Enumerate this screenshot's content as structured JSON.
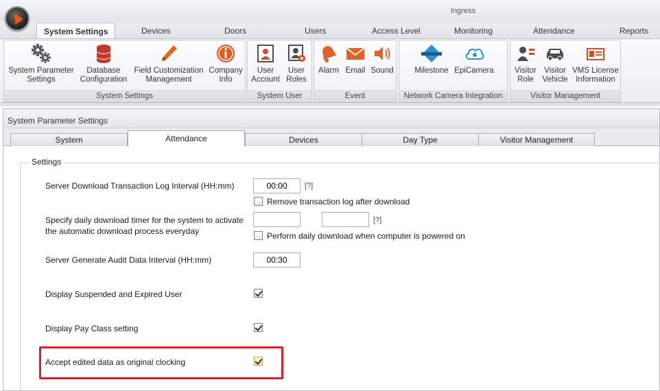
{
  "app": {
    "title": "Ingress"
  },
  "ribbon_tabs": [
    {
      "label": "System Settings",
      "active": true
    },
    {
      "label": "Devices"
    },
    {
      "label": "Doors"
    },
    {
      "label": "Users"
    },
    {
      "label": "Access Level"
    },
    {
      "label": "Monitoring"
    },
    {
      "label": "Attendance"
    },
    {
      "label": "Reports"
    }
  ],
  "ribbon_groups": {
    "system_settings": {
      "label": "System Settings",
      "buttons": [
        {
          "label": "System Parameter\nSettings",
          "icon": "gears-icon"
        },
        {
          "label": "Database\nConfiguration",
          "icon": "database-icon"
        },
        {
          "label": "Field Customization\nManagement",
          "icon": "pencil-icon"
        },
        {
          "label": "Company\nInfo",
          "icon": "info-icon"
        }
      ]
    },
    "system_user": {
      "label": "System User",
      "buttons": [
        {
          "label": "User\nAccount",
          "icon": "user-account-icon"
        },
        {
          "label": "User\nRoles",
          "icon": "user-roles-icon"
        }
      ]
    },
    "event": {
      "label": "Event",
      "buttons": [
        {
          "label": "Alarm",
          "icon": "alarm-bell-icon"
        },
        {
          "label": "Email",
          "icon": "email-icon"
        },
        {
          "label": "Sound",
          "icon": "speaker-icon"
        }
      ]
    },
    "network_camera": {
      "label": "Network Camera Integration",
      "buttons": [
        {
          "label": "Milestone",
          "icon": "milestone-icon",
          "logo_text": "milestone"
        },
        {
          "label": "EpiCamera",
          "icon": "cloud-camera-icon"
        }
      ]
    },
    "visitor_management": {
      "label": "Visitor Management",
      "buttons": [
        {
          "label": "Visitor\nRole",
          "icon": "visitor-role-icon"
        },
        {
          "label": "Visitor\nVehicle",
          "icon": "car-icon"
        },
        {
          "label": "VMS License\nInformation",
          "icon": "license-card-icon"
        }
      ]
    }
  },
  "panel": {
    "title": "System Parameter Settings",
    "tabs": [
      {
        "label": "System"
      },
      {
        "label": "Attendance",
        "active": true
      },
      {
        "label": "Devices"
      },
      {
        "label": "Day Type"
      },
      {
        "label": "Visitor Management"
      }
    ]
  },
  "settings": {
    "legend": "Settings",
    "download_interval": {
      "label": "Server Download Transaction Log Interval (HH:mm)",
      "value": "00:00",
      "help": "[?]",
      "remove_log_label": "Remove transaction log after download",
      "remove_log_checked": false
    },
    "daily_timer": {
      "label_line1": "Specify daily download timer for the system to activate",
      "label_line2": "the automatic download process everyday",
      "value1": "",
      "value2": "",
      "help": "[?]",
      "powered_on_label": "Perform daily download when computer is powered on",
      "powered_on_checked": false
    },
    "audit_interval": {
      "label": "Server Generate Audit Data Interval (HH:mm)",
      "value": "00:30"
    },
    "display_suspended": {
      "label": "Display Suspended and Expired User",
      "checked": true
    },
    "display_pay_class": {
      "label": "Display Pay Class setting",
      "checked": true
    },
    "accept_edited": {
      "label": "Accept edited data as original clocking",
      "checked": true
    }
  },
  "colors": {
    "highlight_box": "#e21b23",
    "orb_accent": "#e8571b",
    "database_icon": "#c0392b",
    "pencil_icon": "#e8641f",
    "info_icon": "#e8571b",
    "event_icons": "#e0632a",
    "camera_icons": "#2a8fd6",
    "visitor_icons": "#d64b1f"
  }
}
